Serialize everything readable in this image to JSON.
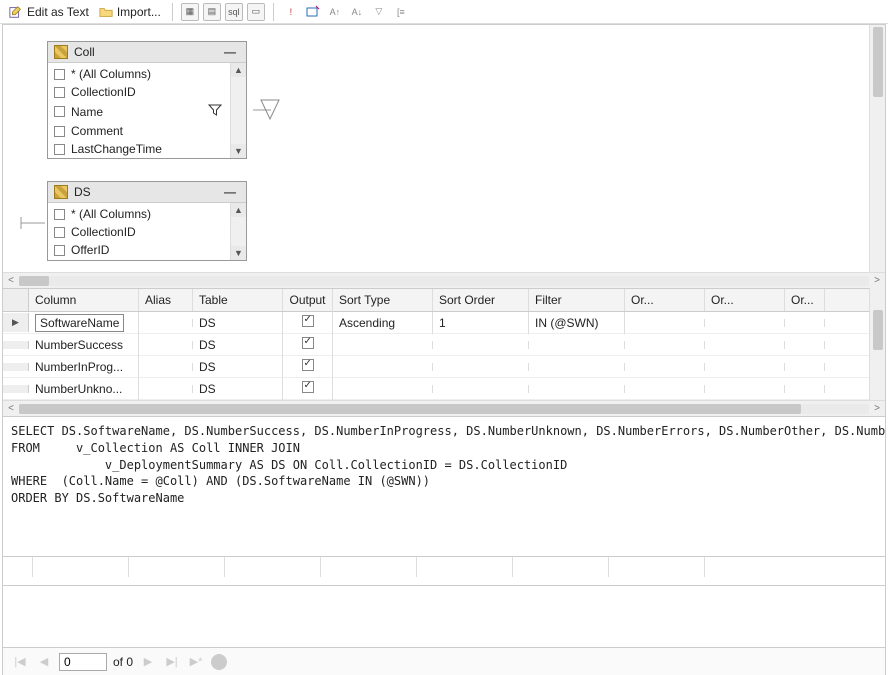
{
  "toolbar": {
    "edit_as_text": "Edit as Text",
    "import": "Import..."
  },
  "diagram": {
    "tables": [
      {
        "name": "Coll",
        "columns": [
          "* (All Columns)",
          "CollectionID",
          "Name",
          "Comment",
          "LastChangeTime"
        ],
        "filtered_column_index": 2
      },
      {
        "name": "DS",
        "columns": [
          "* (All Columns)",
          "CollectionID",
          "OfferID"
        ]
      }
    ]
  },
  "criteria": {
    "headers": {
      "column": "Column",
      "alias": "Alias",
      "table": "Table",
      "output": "Output",
      "sort_type": "Sort Type",
      "sort_order": "Sort Order",
      "filter": "Filter",
      "or1": "Or...",
      "or2": "Or...",
      "or3": "Or..."
    },
    "rows": [
      {
        "column": "SoftwareName",
        "alias": "",
        "table": "DS",
        "output": true,
        "sort_type": "Ascending",
        "sort_order": "1",
        "filter": "IN (@SWN)",
        "selected": true
      },
      {
        "column": "NumberSuccess",
        "alias": "",
        "table": "DS",
        "output": true,
        "sort_type": "",
        "sort_order": "",
        "filter": ""
      },
      {
        "column": "NumberInProg...",
        "alias": "",
        "table": "DS",
        "output": true,
        "sort_type": "",
        "sort_order": "",
        "filter": ""
      },
      {
        "column": "NumberUnkno...",
        "alias": "",
        "table": "DS",
        "output": true,
        "sort_type": "",
        "sort_order": "",
        "filter": ""
      }
    ]
  },
  "sql": "SELECT DS.SoftwareName, DS.NumberSuccess, DS.NumberInProgress, DS.NumberUnknown, DS.NumberErrors, DS.NumberOther, DS.NumberTotal\nFROM     v_Collection AS Coll INNER JOIN\n             v_DeploymentSummary AS DS ON Coll.CollectionID = DS.CollectionID\nWHERE  (Coll.Name = @Coll) AND (DS.SoftwareName IN (@SWN))\nORDER BY DS.SoftwareName",
  "pager": {
    "current": "0",
    "of": "of 0"
  }
}
